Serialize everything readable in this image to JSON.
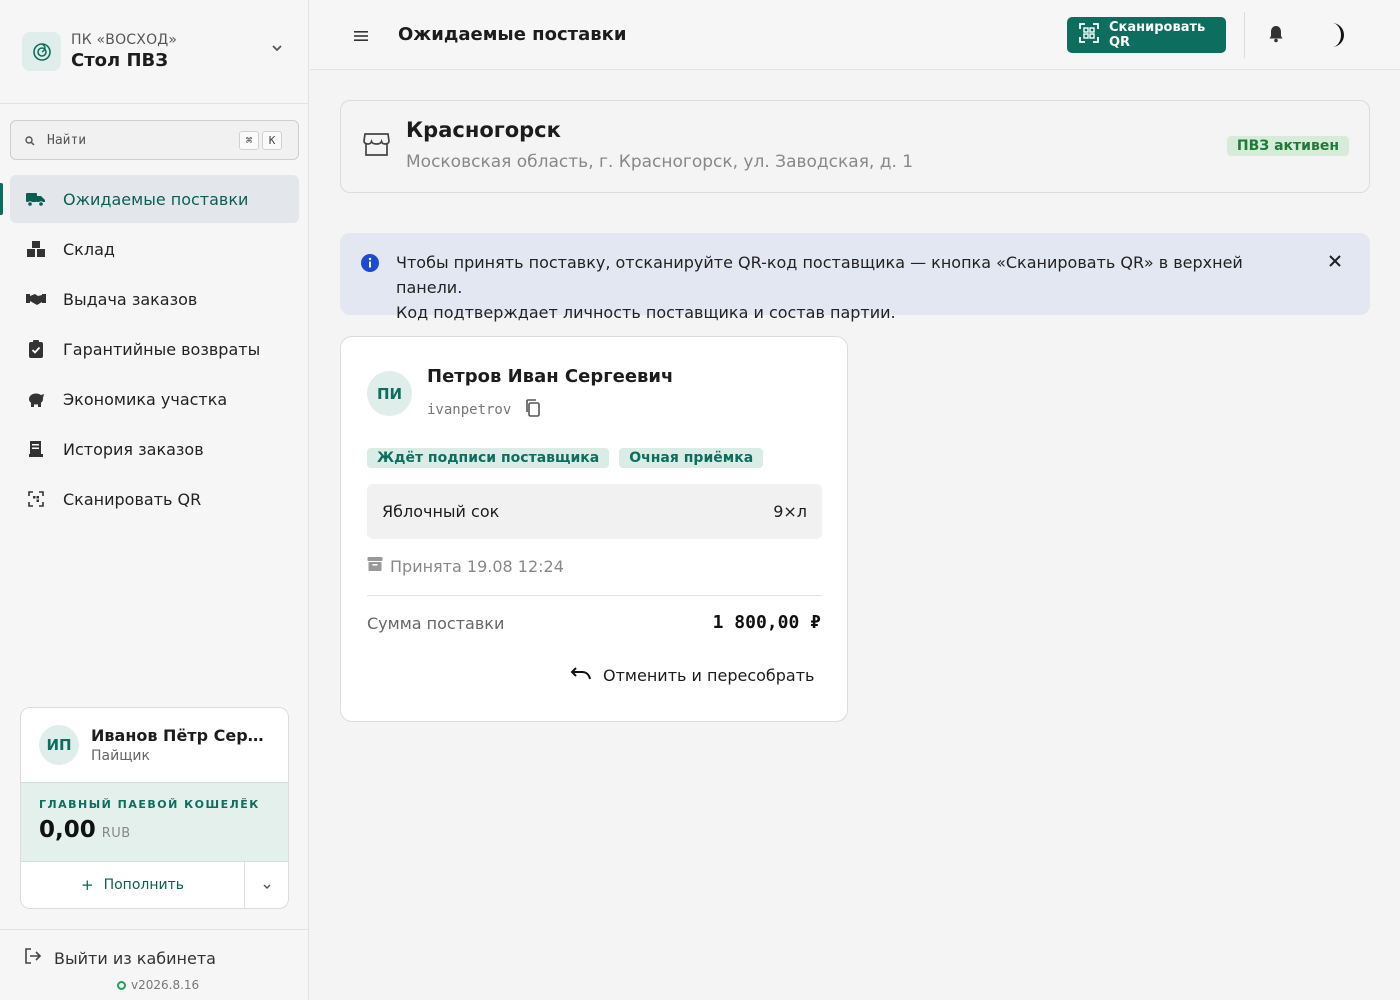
{
  "brand": {
    "org": "ПК «ВОСХОД»",
    "name": "Стол ПВЗ"
  },
  "search": {
    "placeholder": "Найти",
    "shortcut_mod": "⌘",
    "shortcut_key": "K"
  },
  "sidebar": {
    "items": [
      {
        "label": "Ожидаемые поставки",
        "icon": "truck-icon",
        "active": true
      },
      {
        "label": "Склад",
        "icon": "boxes-icon"
      },
      {
        "label": "Выдача заказов",
        "icon": "handshake-icon"
      },
      {
        "label": "Гарантийные возвраты",
        "icon": "clipboard-check-icon"
      },
      {
        "label": "Экономика участка",
        "icon": "piggy-bank-icon"
      },
      {
        "label": "История заказов",
        "icon": "receipt-icon"
      },
      {
        "label": "Сканировать QR",
        "icon": "qr-scan-icon"
      }
    ]
  },
  "user": {
    "initials": "ИП",
    "name": "Иванов Пётр Сергеевич",
    "role": "Пайщик"
  },
  "wallet": {
    "title": "ГЛАВНЫЙ ПАЕВОЙ КОШЕЛЁК",
    "amount": "0,00",
    "currency": "RUB",
    "topup_label": "Пополнить"
  },
  "footer": {
    "logout_label": "Выйти из кабинета",
    "version": "v2026.8.16"
  },
  "topbar": {
    "title": "Ожидаемые поставки",
    "scan_label": "Сканировать QR"
  },
  "location": {
    "city": "Красногорск",
    "address": "Московская область, г. Красногорск, ул. Заводская, д. 1",
    "status": "ПВЗ активен"
  },
  "info": {
    "line1": "Чтобы принять поставку, отсканируйте QR-код поставщика — кнопка «Сканировать QR» в верхней панели.",
    "line2": "Код подтверждает личность поставщика и состав партии."
  },
  "delivery": {
    "initials": "ПИ",
    "supplier_name": "Петров Иван Сергеевич",
    "login": "ivanpetrov",
    "tags": [
      "Ждёт подписи поставщика",
      "Очная приёмка"
    ],
    "item_name": "Яблочный сок",
    "item_qty": "9×л",
    "accepted": "Принята 19.08 12:24",
    "sum_label": "Сумма поставки",
    "sum_value": "1 800,00 ₽",
    "cancel_label": "Отменить и пересобрать"
  },
  "colors": {
    "accent": "#0d6e5f",
    "info_bg": "#e3e7f2",
    "status_green": "#1e7a3a"
  }
}
